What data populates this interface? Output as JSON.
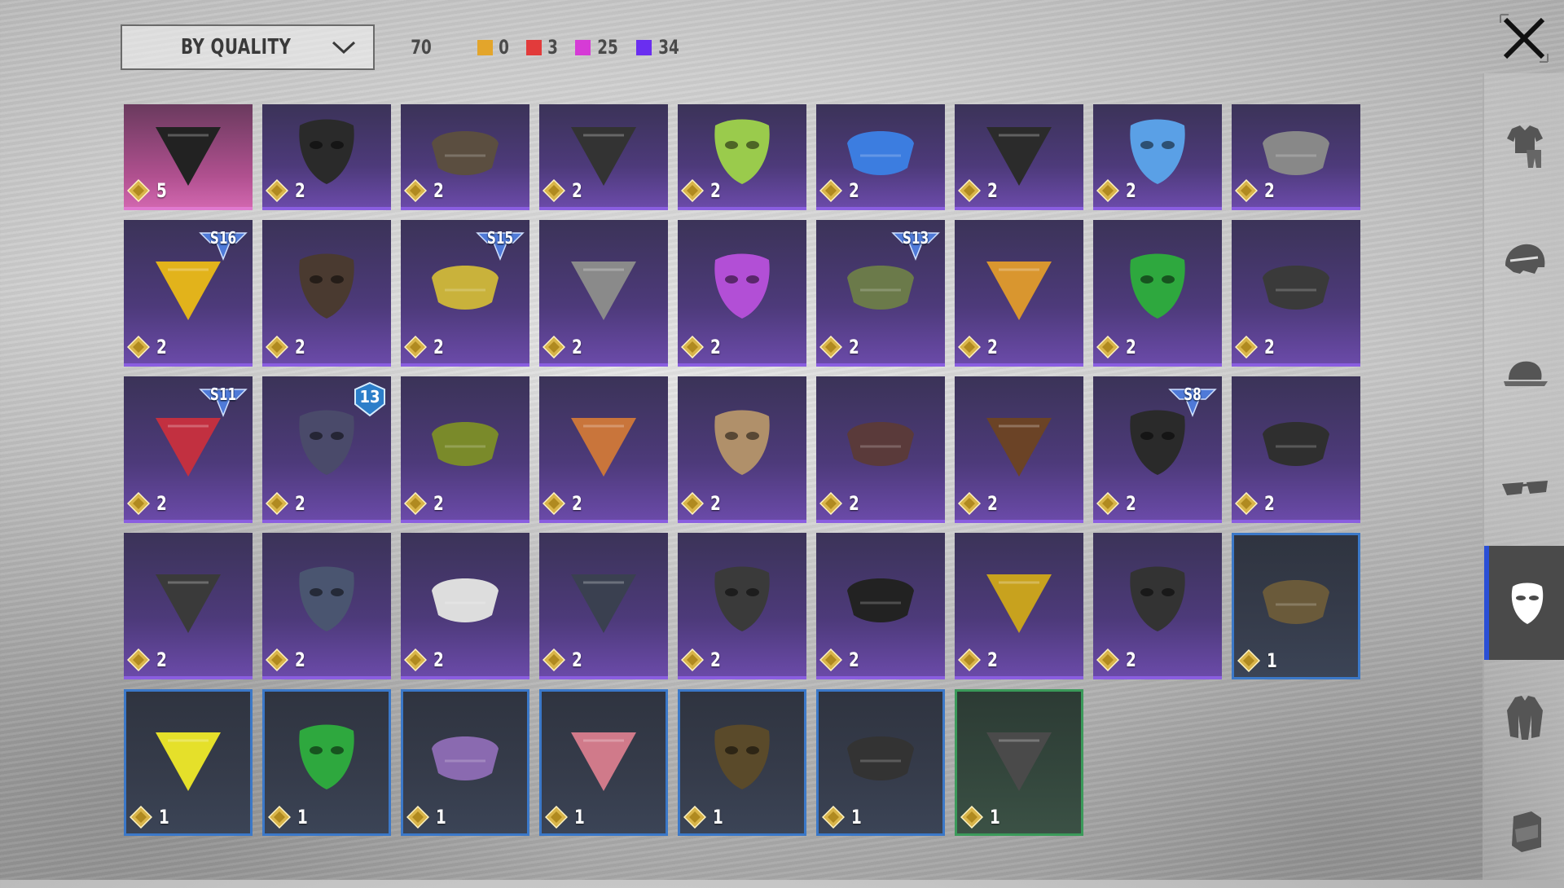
{
  "sort": {
    "label": "BY QUALITY"
  },
  "counts": {
    "total": "70",
    "orange": "0",
    "red": "3",
    "pink": "25",
    "purple": "34"
  },
  "colors": {
    "orange": "#e3a52b",
    "red": "#e23b3b",
    "pink": "#d63bd6",
    "purple": "#6a2ef0",
    "accent_blue": "#2a4fd6"
  },
  "sidebar": {
    "tabs": [
      {
        "icon": "outfit-icon"
      },
      {
        "icon": "helmet-icon"
      },
      {
        "icon": "cap-icon"
      },
      {
        "icon": "glasses-icon"
      },
      {
        "icon": "mask-icon",
        "active": true
      },
      {
        "icon": "jacket-icon"
      },
      {
        "icon": "backpack-icon"
      }
    ]
  },
  "items": [
    {
      "qty": "5",
      "rarity": "pink",
      "icon": "black-bandana-icon"
    },
    {
      "qty": "2",
      "rarity": "purple",
      "icon": "black-half-mask-icon"
    },
    {
      "qty": "2",
      "rarity": "purple",
      "icon": "armored-mask-icon"
    },
    {
      "qty": "2",
      "rarity": "purple",
      "icon": "cyber-visor-icon"
    },
    {
      "qty": "2",
      "rarity": "purple",
      "icon": "green-cactus-bandana-icon"
    },
    {
      "qty": "2",
      "rarity": "purple",
      "icon": "blue-white-bandana-icon"
    },
    {
      "qty": "2",
      "rarity": "purple",
      "icon": "led-face-mask-icon"
    },
    {
      "qty": "2",
      "rarity": "purple",
      "icon": "blue-visor-mask-icon"
    },
    {
      "qty": "2",
      "rarity": "purple",
      "icon": "skull-face-mask-icon"
    },
    {
      "qty": "2",
      "rarity": "purple",
      "icon": "yellow-tactical-mask-icon",
      "season": "S16"
    },
    {
      "qty": "2",
      "rarity": "purple",
      "icon": "brown-bandana-icon"
    },
    {
      "qty": "2",
      "rarity": "purple",
      "icon": "gold-horned-mask-icon",
      "season": "S15"
    },
    {
      "qty": "2",
      "rarity": "purple",
      "icon": "silver-eye-mask-icon"
    },
    {
      "qty": "2",
      "rarity": "purple",
      "icon": "purple-gas-mask-icon"
    },
    {
      "qty": "2",
      "rarity": "purple",
      "icon": "goggle-mask-icon",
      "season": "S13"
    },
    {
      "qty": "2",
      "rarity": "purple",
      "icon": "orange-gaiter-icon"
    },
    {
      "qty": "2",
      "rarity": "purple",
      "icon": "green-gaiter-icon"
    },
    {
      "qty": "2",
      "rarity": "purple",
      "icon": "black-gaiter-icon"
    },
    {
      "qty": "2",
      "rarity": "purple",
      "icon": "red-mouth-guard-icon",
      "season": "S11"
    },
    {
      "qty": "2",
      "rarity": "purple",
      "icon": "tech-respirator-icon",
      "badge": "13"
    },
    {
      "qty": "2",
      "rarity": "purple",
      "icon": "green-checkered-scarf-icon"
    },
    {
      "qty": "2",
      "rarity": "purple",
      "icon": "orange-plaid-scarf-icon"
    },
    {
      "qty": "2",
      "rarity": "purple",
      "icon": "vintage-gas-mask-icon"
    },
    {
      "qty": "2",
      "rarity": "purple",
      "icon": "red-camo-mask-icon"
    },
    {
      "qty": "2",
      "rarity": "purple",
      "icon": "mustache-icon"
    },
    {
      "qty": "2",
      "rarity": "purple",
      "icon": "flame-balaclava-icon",
      "season": "S8"
    },
    {
      "qty": "2",
      "rarity": "purple",
      "icon": "hockey-mask-icon"
    },
    {
      "qty": "2",
      "rarity": "purple",
      "icon": "black-cloth-mask-icon"
    },
    {
      "qty": "2",
      "rarity": "purple",
      "icon": "full-gas-mask-icon"
    },
    {
      "qty": "2",
      "rarity": "purple",
      "icon": "white-camo-mask-icon"
    },
    {
      "qty": "2",
      "rarity": "purple",
      "icon": "dark-skull-mask-icon"
    },
    {
      "qty": "2",
      "rarity": "purple",
      "icon": "tactical-face-guard-icon"
    },
    {
      "qty": "2",
      "rarity": "purple",
      "icon": "black-scarf-icon"
    },
    {
      "qty": "2",
      "rarity": "purple",
      "icon": "gold-glitter-mask-icon"
    },
    {
      "qty": "2",
      "rarity": "purple",
      "icon": "black-steel-mask-icon"
    },
    {
      "qty": "1",
      "rarity": "blue",
      "icon": "rusty-skull-mask-icon"
    },
    {
      "qty": "1",
      "rarity": "blue",
      "icon": "yellow-dot-bandana-icon"
    },
    {
      "qty": "1",
      "rarity": "blue",
      "icon": "spiderweb-bandana-icon"
    },
    {
      "qty": "1",
      "rarity": "blue",
      "icon": "purple-theater-mask-icon"
    },
    {
      "qty": "1",
      "rarity": "blue",
      "icon": "pink-theater-mask-icon"
    },
    {
      "qty": "1",
      "rarity": "blue",
      "icon": "skull-print-mask-icon"
    },
    {
      "qty": "1",
      "rarity": "blue",
      "icon": "half-respirator-icon"
    },
    {
      "qty": "1",
      "rarity": "green",
      "icon": "military-gas-mask-icon"
    }
  ]
}
